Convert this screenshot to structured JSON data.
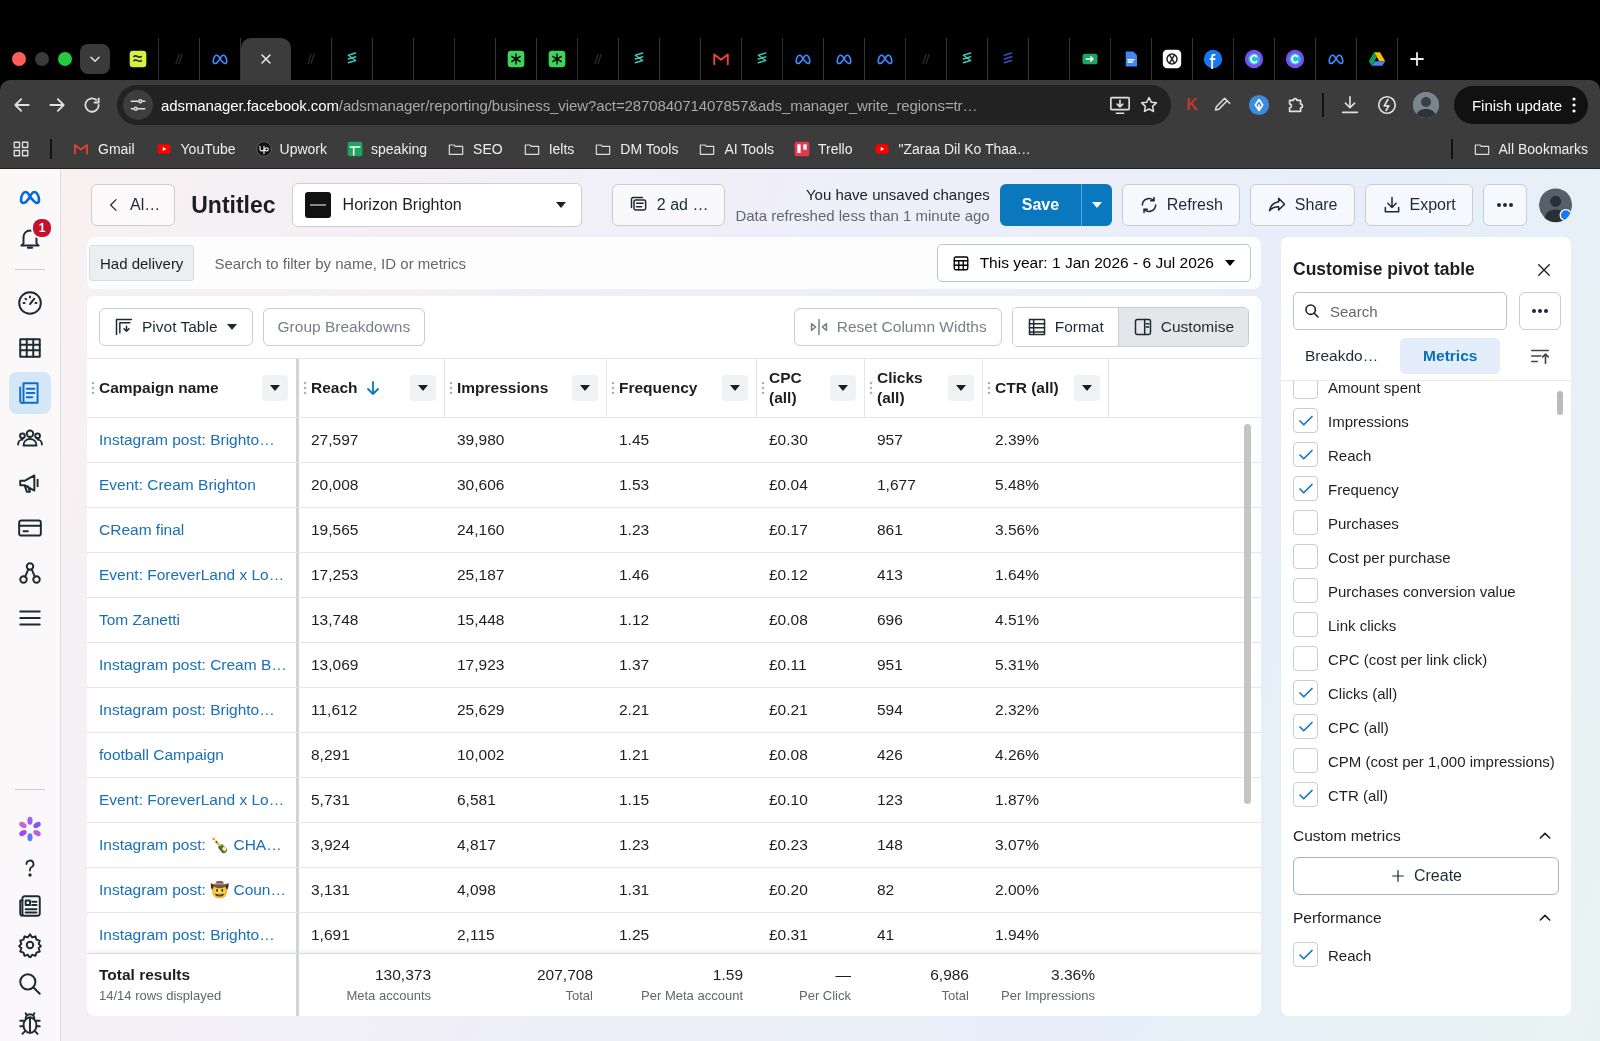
{
  "browser": {
    "tabs": [
      {
        "kind": "squiggle",
        "selected": false
      },
      {
        "kind": "dark",
        "selected": false
      },
      {
        "kind": "meta",
        "selected": false
      },
      {
        "kind": "close",
        "selected": true
      },
      {
        "kind": "dark",
        "selected": false
      },
      {
        "kind": "teal",
        "selected": false
      },
      {
        "kind": "blank",
        "selected": false
      },
      {
        "kind": "blank",
        "selected": false
      },
      {
        "kind": "blank",
        "selected": false
      },
      {
        "kind": "asterisk",
        "selected": false
      },
      {
        "kind": "asterisk",
        "selected": false
      },
      {
        "kind": "dark",
        "selected": false
      },
      {
        "kind": "teal",
        "selected": false
      },
      {
        "kind": "blank",
        "selected": false
      },
      {
        "kind": "gmail",
        "selected": false
      },
      {
        "kind": "teal",
        "selected": false
      },
      {
        "kind": "meta",
        "selected": false
      },
      {
        "kind": "meta",
        "selected": false
      },
      {
        "kind": "meta",
        "selected": false
      },
      {
        "kind": "dark",
        "selected": false
      },
      {
        "kind": "teal",
        "selected": false
      },
      {
        "kind": "navy",
        "selected": false
      },
      {
        "kind": "blank",
        "selected": false
      },
      {
        "kind": "meet",
        "selected": false
      },
      {
        "kind": "doc",
        "selected": false
      },
      {
        "kind": "knot",
        "selected": false
      },
      {
        "kind": "facebook",
        "selected": false
      },
      {
        "kind": "canva",
        "selected": false
      },
      {
        "kind": "canva",
        "selected": false
      },
      {
        "kind": "meta",
        "selected": false
      },
      {
        "kind": "drive",
        "selected": false
      }
    ],
    "address": {
      "host": "adsmanager.facebook.com",
      "path": "/adsmanager/reporting/business_view?act=287084071407857&ads_manager_write_regions=tr…"
    },
    "extension_letter": "K",
    "update_button": "Finish update",
    "bookmarks": [
      {
        "kind": "gmail",
        "label": "Gmail"
      },
      {
        "kind": "youtube",
        "label": "YouTube"
      },
      {
        "kind": "upwork",
        "label": "Upwork"
      },
      {
        "kind": "sheets",
        "label": "speaking"
      },
      {
        "kind": "folder",
        "label": "SEO"
      },
      {
        "kind": "folder",
        "label": "Ielts"
      },
      {
        "kind": "folder",
        "label": "DM Tools"
      },
      {
        "kind": "folder",
        "label": "AI Tools"
      },
      {
        "kind": "trello",
        "label": "Trello"
      },
      {
        "kind": "youtube",
        "label": "\"Zaraa Dil Ko Thaa…"
      }
    ],
    "all_bookmarks": "All Bookmarks"
  },
  "rail": {
    "badge": "1",
    "items": [
      {
        "kind": "gauge",
        "selected": false
      },
      {
        "kind": "table",
        "selected": false
      },
      {
        "kind": "reports",
        "selected": true
      },
      {
        "kind": "people",
        "selected": false
      },
      {
        "kind": "megaphone",
        "selected": false
      },
      {
        "kind": "card",
        "selected": false
      },
      {
        "kind": "hierarchy",
        "selected": false
      },
      {
        "kind": "menu",
        "selected": false
      }
    ]
  },
  "header": {
    "back": "Al…",
    "title": "Untitlec",
    "account": "Horizon Brighton",
    "ads": "2 ad …",
    "status": "You have unsaved changes",
    "refreshed": "Data refreshed less than 1 minute ago",
    "save": "Save",
    "refresh": "Refresh",
    "share": "Share",
    "export": "Export"
  },
  "filter": {
    "chip": "Had delivery",
    "placeholder": "Search to filter by name, ID or metrics",
    "date_range": "This year: 1 Jan 2026 - 6 Jul 2026"
  },
  "toolbar": {
    "pivot": "Pivot Table",
    "group": {
      "label": "Group Breakdowns",
      "disabled": true
    },
    "reset": {
      "label": "Reset Column Widths",
      "disabled": true
    },
    "format": {
      "label": "Format",
      "selected": false
    },
    "customise": {
      "label": "Customise",
      "selected": true
    }
  },
  "table": {
    "columns": [
      {
        "label": "Campaign name",
        "sorted": false
      },
      {
        "label": "Reach",
        "sorted": true
      },
      {
        "label": "Impressions",
        "sorted": false
      },
      {
        "label": "Frequency",
        "sorted": false
      },
      {
        "label": "CPC (all)",
        "sorted": false
      },
      {
        "label": "Clicks (all)",
        "sorted": false
      },
      {
        "label": "CTR (all)",
        "sorted": false
      }
    ],
    "rows": [
      [
        "Instagram post: Brighto…",
        "27,597",
        "39,980",
        "1.45",
        "£0.30",
        "957",
        "2.39%"
      ],
      [
        "Event: Cream Brighton",
        "20,008",
        "30,606",
        "1.53",
        "£0.04",
        "1,677",
        "5.48%"
      ],
      [
        "CReam final",
        "19,565",
        "24,160",
        "1.23",
        "£0.17",
        "861",
        "3.56%"
      ],
      [
        "Event: ForeverLand x Lo…",
        "17,253",
        "25,187",
        "1.46",
        "£0.12",
        "413",
        "1.64%"
      ],
      [
        "Tom Zanetti",
        "13,748",
        "15,448",
        "1.12",
        "£0.08",
        "696",
        "4.51%"
      ],
      [
        "Instagram post: Cream B…",
        "13,069",
        "17,923",
        "1.37",
        "£0.11",
        "951",
        "5.31%"
      ],
      [
        "Instagram post: Brighto…",
        "11,612",
        "25,629",
        "2.21",
        "£0.21",
        "594",
        "2.32%"
      ],
      [
        "football Campaign",
        "8,291",
        "10,002",
        "1.21",
        "£0.08",
        "426",
        "4.26%"
      ],
      [
        "Event: ForeverLand x Lo…",
        "5,731",
        "6,581",
        "1.15",
        "£0.10",
        "123",
        "1.87%"
      ],
      [
        "Instagram post: 🍾 CHA…",
        "3,924",
        "4,817",
        "1.23",
        "£0.23",
        "148",
        "3.07%"
      ],
      [
        "Instagram post: 🤠 Coun…",
        "3,131",
        "4,098",
        "1.31",
        "£0.20",
        "82",
        "2.00%"
      ],
      [
        "Instagram post: Brighto…",
        "1,691",
        "2,115",
        "1.25",
        "£0.31",
        "41",
        "1.94%"
      ]
    ],
    "total": {
      "title": "Total results",
      "subtitle": "14/14 rows displayed"
    },
    "totals": [
      {
        "value": "130,373",
        "label": "Meta accounts"
      },
      {
        "value": "207,708",
        "label": "Total"
      },
      {
        "value": "1.59",
        "label": "Per Meta account"
      },
      {
        "value": "—",
        "label": "Per Click"
      },
      {
        "value": "6,986",
        "label": "Total"
      },
      {
        "value": "3.36%",
        "label": "Per Impressions"
      }
    ]
  },
  "panel": {
    "title": "Customise pivot table",
    "search_placeholder": "Search",
    "tabs": [
      {
        "label": "Breakdo…",
        "selected": false
      },
      {
        "label": "Metrics",
        "selected": true
      }
    ],
    "metrics": [
      {
        "label": "Amount spent",
        "checked": false
      },
      {
        "label": "Impressions",
        "checked": true
      },
      {
        "label": "Reach",
        "checked": true
      },
      {
        "label": "Frequency",
        "checked": true
      },
      {
        "label": "Purchases",
        "checked": false
      },
      {
        "label": "Cost per purchase",
        "checked": false
      },
      {
        "label": "Purchases conversion value",
        "checked": false
      },
      {
        "label": "Link clicks",
        "checked": false
      },
      {
        "label": "CPC (cost per link click)",
        "checked": false
      },
      {
        "label": "Clicks (all)",
        "checked": true
      },
      {
        "label": "CPC (all)",
        "checked": true
      },
      {
        "label": "CPM (cost per 1,000 impressions)",
        "checked": false
      },
      {
        "label": "CTR (all)",
        "checked": true
      }
    ],
    "sections": [
      {
        "title": "Custom metrics",
        "expanded": true,
        "button": "Create"
      },
      {
        "title": "Performance",
        "expanded": true,
        "items": [
          {
            "label": "Reach",
            "checked": true
          }
        ]
      }
    ]
  }
}
